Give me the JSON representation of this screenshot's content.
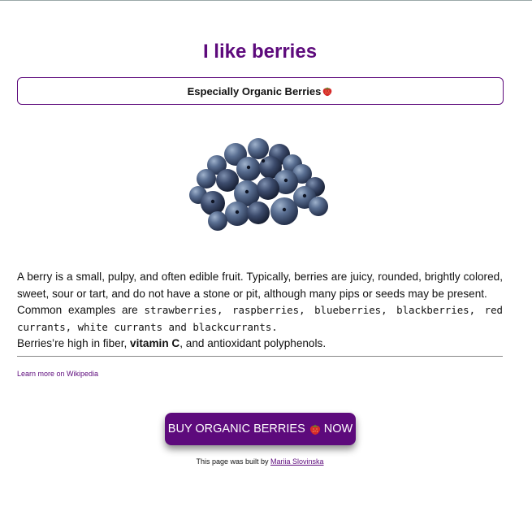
{
  "header": {
    "title": "I like berries",
    "subtitle": "Especially Organic Berries"
  },
  "image": {
    "icon": "blueberries-image"
  },
  "description": {
    "line1": "A berry is a small, pulpy, and often edible fruit. Typically, berries are juicy, rounded, brightly colored, sweet, sour or tart, and do not have a stone or pit, although many pips or seeds may be present.",
    "examples_intro": "Common examples are",
    "examples_list": "strawberries, raspberries, blueberries, blackberries, red currants, white currants and blackcurrants.",
    "fiber_prefix": "Berries’re high in fiber,",
    "fiber_bold": "vitamin C",
    "fiber_suffix": ", and antioxidant polyphenols."
  },
  "links": {
    "wikipedia": "Learn more on Wikipedia"
  },
  "cta": {
    "label_before": "BUY ORGANIC BERRIES",
    "label_after": "NOW"
  },
  "footer": {
    "text": "This page was built by",
    "author": "Mariia Slovinska"
  },
  "colors": {
    "accent": "#5d0a7c",
    "text": "#111111",
    "background": "#ffffff"
  }
}
